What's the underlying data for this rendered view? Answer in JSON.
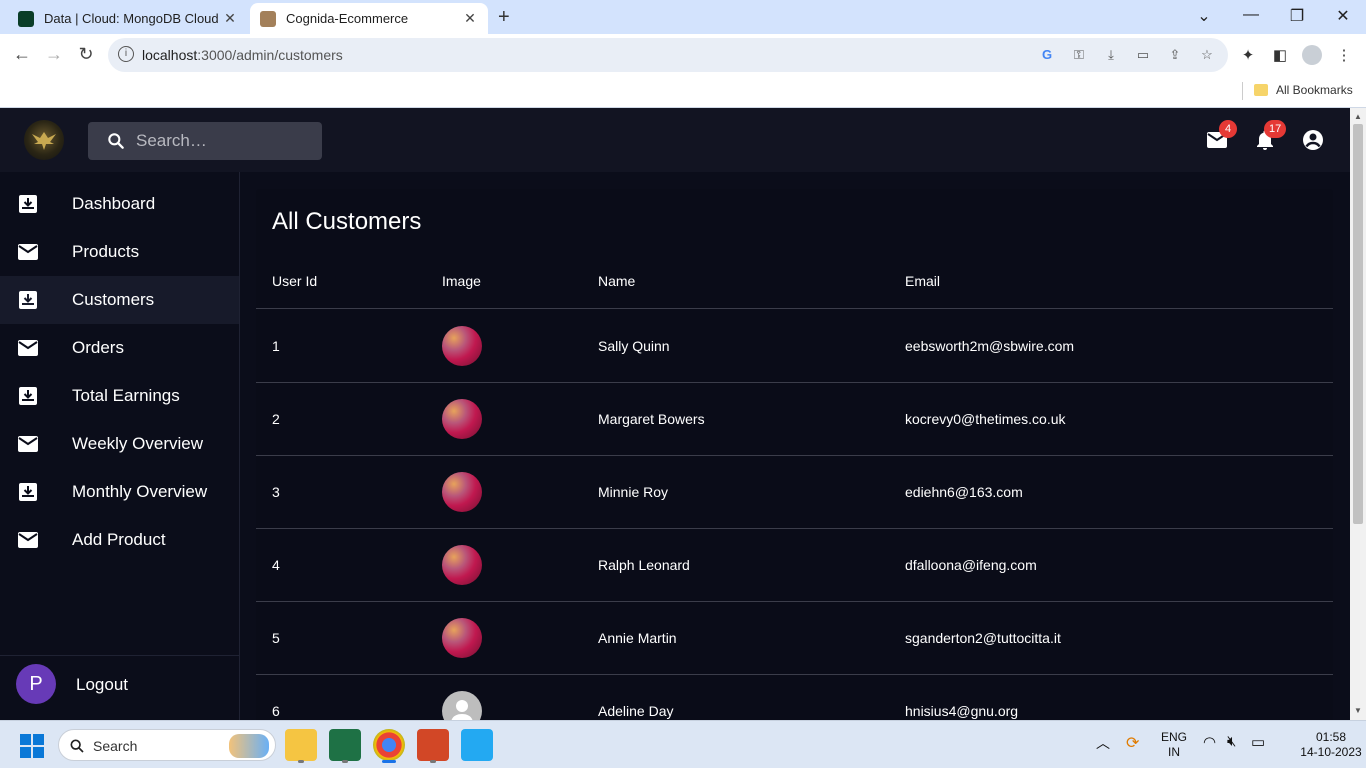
{
  "browser": {
    "tabs": [
      {
        "title": "Data | Cloud: MongoDB Cloud",
        "active": false,
        "favicon_color": "#0a3d28"
      },
      {
        "title": "Cognida-Ecommerce",
        "active": true,
        "favicon_color": "#a3805a"
      }
    ],
    "url_host": "localhost",
    "url_path": ":3000/admin/customers",
    "bookmarks_label": "All Bookmarks"
  },
  "app": {
    "search_placeholder": "Search…",
    "mail_badge": "4",
    "notification_badge": "17",
    "sidebar": [
      {
        "label": "Dashboard",
        "icon": "inbox-download-icon",
        "active": false
      },
      {
        "label": "Products",
        "icon": "mail-icon",
        "active": false
      },
      {
        "label": "Customers",
        "icon": "inbox-download-icon",
        "active": true
      },
      {
        "label": "Orders",
        "icon": "mail-icon",
        "active": false
      },
      {
        "label": "Total Earnings",
        "icon": "inbox-download-icon",
        "active": false
      },
      {
        "label": "Weekly Overview",
        "icon": "mail-icon",
        "active": false
      },
      {
        "label": "Monthly Overview",
        "icon": "inbox-download-icon",
        "active": false
      },
      {
        "label": "Add Product",
        "icon": "mail-icon",
        "active": false
      }
    ],
    "avatar_letter": "P",
    "logout_label": "Logout",
    "page_title": "All Customers",
    "table": {
      "columns": [
        "User Id",
        "Image",
        "Name",
        "Email"
      ],
      "rows": [
        {
          "id": "1",
          "image": "photo",
          "name": "Sally Quinn",
          "email": "eebsworth2m@sbwire.com"
        },
        {
          "id": "2",
          "image": "photo",
          "name": "Margaret Bowers",
          "email": "kocrevy0@thetimes.co.uk"
        },
        {
          "id": "3",
          "image": "photo",
          "name": "Minnie Roy",
          "email": "ediehn6@163.com"
        },
        {
          "id": "4",
          "image": "photo",
          "name": "Ralph Leonard",
          "email": "dfalloona@ifeng.com"
        },
        {
          "id": "5",
          "image": "photo",
          "name": "Annie Martin",
          "email": "sganderton2@tuttocitta.it"
        },
        {
          "id": "6",
          "image": "default",
          "name": "Adeline Day",
          "email": "hnisius4@gnu.org"
        }
      ]
    }
  },
  "taskbar": {
    "search_label": "Search",
    "lang_line1": "ENG",
    "lang_line2": "IN",
    "time": "01:58",
    "date": "14-10-2023"
  }
}
